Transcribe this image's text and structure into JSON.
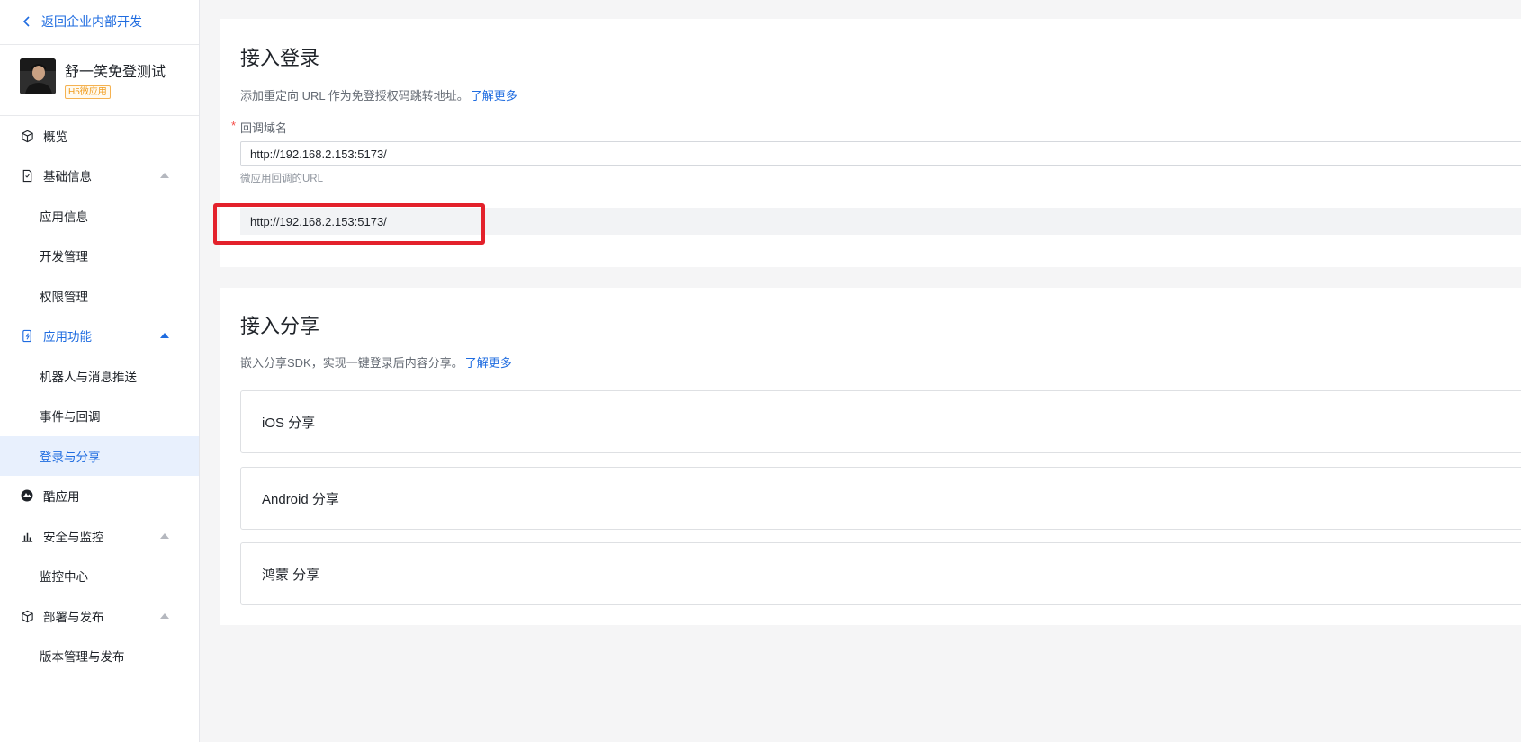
{
  "sidebar": {
    "back_label": "返回企业内部开发",
    "app": {
      "name": "舒一笑免登测试",
      "badge": "H5微应用"
    },
    "items": [
      {
        "label": "概览",
        "icon": "cube-icon"
      },
      {
        "label": "基础信息",
        "icon": "document-icon"
      },
      {
        "label": "应用信息"
      },
      {
        "label": "开发管理"
      },
      {
        "label": "权限管理"
      },
      {
        "label": "应用功能",
        "icon": "phone-lightning-icon"
      },
      {
        "label": "机器人与消息推送"
      },
      {
        "label": "事件与回调"
      },
      {
        "label": "登录与分享"
      },
      {
        "label": "酷应用",
        "icon": "cool-app-icon"
      },
      {
        "label": "安全与监控",
        "icon": "bar-chart-icon"
      },
      {
        "label": "监控中心"
      },
      {
        "label": "部署与发布",
        "icon": "package-icon"
      },
      {
        "label": "版本管理与发布"
      }
    ]
  },
  "login_section": {
    "title": "接入登录",
    "desc": "添加重定向 URL 作为免登授权码跳转地址。",
    "learn_more": "了解更多",
    "required_mark": "*",
    "field_label": "回调域名",
    "callback_value": "http://192.168.2.153:5173/",
    "hint": "微应用回调的URL",
    "saved_value": "http://192.168.2.153:5173/"
  },
  "share_section": {
    "title": "接入分享",
    "desc": "嵌入分享SDK，实现一键登录后内容分享。",
    "learn_more": "了解更多",
    "rows": [
      "iOS 分享",
      "Android 分享",
      "鸿蒙 分享"
    ]
  },
  "colors": {
    "accent": "#1f6ce0",
    "highlight": "#e3212b",
    "badge": "#f09a1a"
  }
}
